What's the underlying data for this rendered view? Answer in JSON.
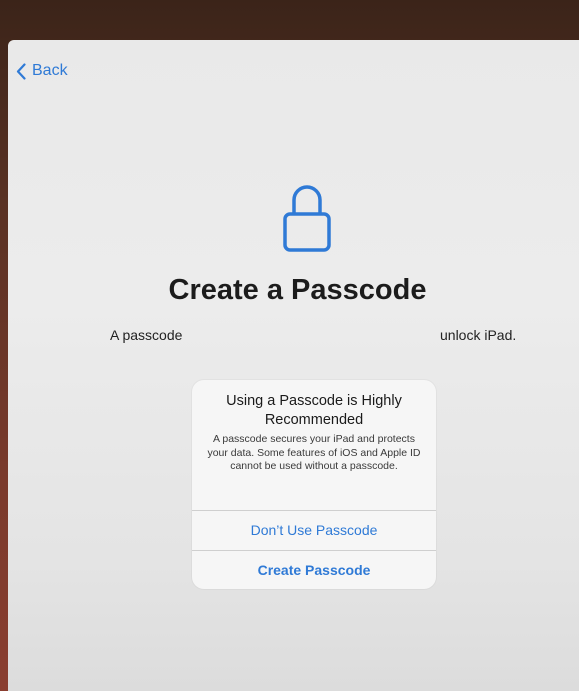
{
  "nav": {
    "back_label": "Back"
  },
  "page": {
    "title": "Create a Passcode",
    "subtitle_left": "A passcode",
    "subtitle_right": "unlock iPad."
  },
  "alert": {
    "title": "Using a Passcode is Highly Recommended",
    "message": "A passcode secures your iPad and protects your data. Some features of iOS and Apple ID cannot be used without a passcode.",
    "dont_use_label": "Don’t Use Passcode",
    "create_label": "Create Passcode"
  },
  "icons": {
    "back": "chevron-left-icon",
    "lock": "lock-icon"
  },
  "colors": {
    "accent": "#2f7ad6",
    "screen_background": "#ebebeb",
    "alert_background": "#f6f6f6"
  }
}
